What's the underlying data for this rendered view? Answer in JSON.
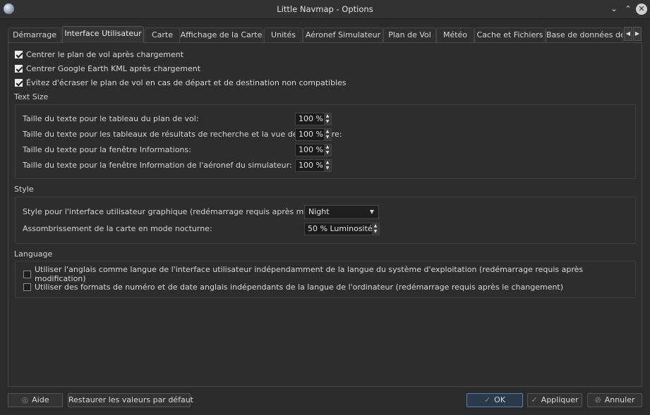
{
  "window": {
    "title": "Little Navmap - Options"
  },
  "tabs": [
    {
      "label": "Démarrage"
    },
    {
      "label": "Interface Utilisateur"
    },
    {
      "label": "Carte"
    },
    {
      "label": "Affichage de la Carte"
    },
    {
      "label": "Unités"
    },
    {
      "label": "Aéronef Simulateur"
    },
    {
      "label": "Plan de Vol"
    },
    {
      "label": "Météo"
    },
    {
      "label": "Cache et Fichiers"
    },
    {
      "label": "Base de données de"
    }
  ],
  "checks": [
    {
      "label": "Centrer le plan de vol après chargement",
      "checked": true
    },
    {
      "label": "Centrer Google Earth KML après chargement",
      "checked": true
    },
    {
      "label": "Évitez d'écraser le plan de vol en cas de départ et de destination non compatibles",
      "checked": true
    }
  ],
  "text_size": {
    "title": "Text Size",
    "rows": [
      {
        "label": "Taille du texte pour le tableau du plan de vol:",
        "value": "100 %"
      },
      {
        "label": "Taille du texte pour les tableaux de résultats de recherche et la vue de procédure:",
        "value": "100 %"
      },
      {
        "label": "Taille du texte pour la fenêtre Informations:",
        "value": "100 %"
      },
      {
        "label": "Taille du texte pour la fenêtre Information de l'aéronef du simulateur:",
        "value": "100 %"
      }
    ]
  },
  "style": {
    "title": "Style",
    "style_label": "Style pour l'interface utilisateur graphique (redémarrage requis après modification):",
    "style_value": "Night",
    "darken_label": "Assombrissement de la carte en mode nocturne:",
    "darken_value": "50 % Luminosité"
  },
  "language": {
    "title": "Language",
    "options": [
      {
        "label": "Utiliser l'anglais comme langue de l'interface utilisateur indépendamment de la langue du système d'exploitation (redémarrage requis après modification)",
        "checked": false
      },
      {
        "label": "Utiliser des formats de numéro et de date anglais indépendants de la langue de l'ordinateur (redémarrage requis après le changement)",
        "checked": false
      }
    ]
  },
  "buttons": {
    "help": "Aide",
    "restore": "Restaurer les valeurs par défaut",
    "ok": "OK",
    "apply": "Appliquer",
    "cancel": "Annuler"
  }
}
